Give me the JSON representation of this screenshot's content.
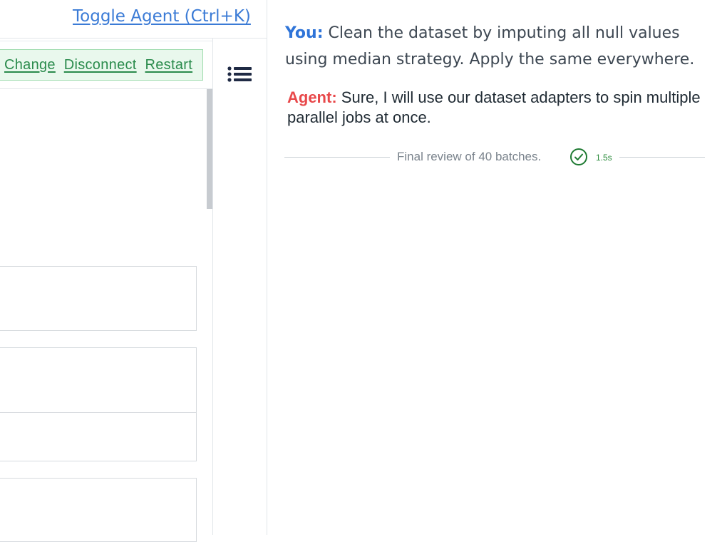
{
  "header": {
    "toggle_agent_label": "Toggle Agent (Ctrl+K)"
  },
  "kernel": {
    "actions": [
      "Change",
      "Disconnect",
      "Restart"
    ]
  },
  "toolbar": {
    "menu_icon": "list-menu-icon"
  },
  "chat": {
    "messages": [
      {
        "sender": "You:",
        "text": "Clean the dataset by imputing all null values using median strategy. Apply the same everywhere."
      },
      {
        "sender": "Agent:",
        "text": "Sure, I will use our dataset adapters to spin multiple parallel jobs at once."
      }
    ],
    "status": {
      "text": "Final review of 40 batches.",
      "duration": "1.5s",
      "icon": "check-circle-icon"
    }
  },
  "colors": {
    "link_blue": "#3b7bd6",
    "kernel_green": "#2a8b4c",
    "kernel_bg": "#e9f8ed",
    "user_label": "#2f74d8",
    "agent_label": "#e8484a",
    "success_green": "#2a8b3b"
  }
}
